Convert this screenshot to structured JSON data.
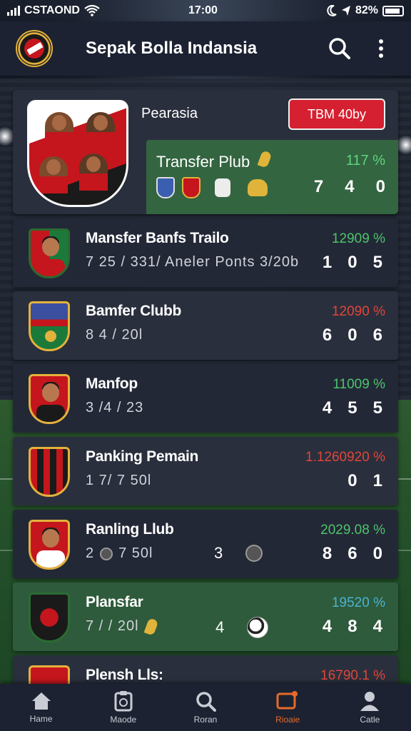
{
  "status_bar": {
    "carrier": "CSTAOND",
    "time": "17:00",
    "battery": "82%"
  },
  "header": {
    "title": "Sepak Bolla Indansia"
  },
  "featured": {
    "name": "Pearasia",
    "button_label": "TBM 40by",
    "sub_title": "Transfer Plub",
    "pct": "117 %",
    "score": [
      "7",
      "4",
      "0"
    ]
  },
  "rows": [
    {
      "title": "Mansfer Banfs Trailo",
      "meta": "7 25 /  331/ Aneler Ponts 3/20b",
      "pct": "12909 %",
      "pct_color": "#4cc46a",
      "score": [
        "1",
        "0",
        "5"
      ]
    },
    {
      "title": "Bamfer Clubb",
      "meta": "8 4 /  20l",
      "pct": "12090 %",
      "pct_color": "#e0463a",
      "score": [
        "6",
        "0",
        "6"
      ]
    },
    {
      "title": "Manfop",
      "meta": "3 /4 / 23",
      "pct": "11009 %",
      "pct_color": "#4cc46a",
      "score": [
        "4",
        "5",
        "5"
      ]
    },
    {
      "title": "Panking Pemain",
      "meta": "1 7/ 7 50l",
      "pct": "1.1260920 %",
      "pct_color": "#e0463a",
      "score": [
        "0",
        "1"
      ]
    },
    {
      "title": "Ranling Llub",
      "meta": "2",
      "meta_extra": "7 50l",
      "mid_value": "3",
      "pct": "2029.08 %",
      "pct_color": "#4cc46a",
      "score": [
        "8",
        "6",
        "0"
      ]
    },
    {
      "title": "Plansfar",
      "meta": "7 / /  20l",
      "mid_value": "4",
      "pct": "19520 %",
      "pct_color": "#4ab3d6",
      "score": [
        "4",
        "8",
        "4"
      ]
    },
    {
      "title": "Plensh Lls:",
      "meta": "",
      "pct": "16790.1 %",
      "pct_color": "#e0463a",
      "score": []
    }
  ],
  "nav": [
    {
      "label": "Hame",
      "icon": "home-icon"
    },
    {
      "label": "Maode",
      "icon": "clipboard-icon"
    },
    {
      "label": "Roran",
      "icon": "search-icon"
    },
    {
      "label": "Rioaie",
      "icon": "message-icon"
    },
    {
      "label": "Catle",
      "icon": "profile-icon"
    }
  ],
  "colors": {
    "header_bg": "#1c2232",
    "card_bg": "#2a2f3d",
    "accent_red": "#d42030",
    "active_nav": "#e86a2a",
    "green_row": "#2e5b3b"
  }
}
